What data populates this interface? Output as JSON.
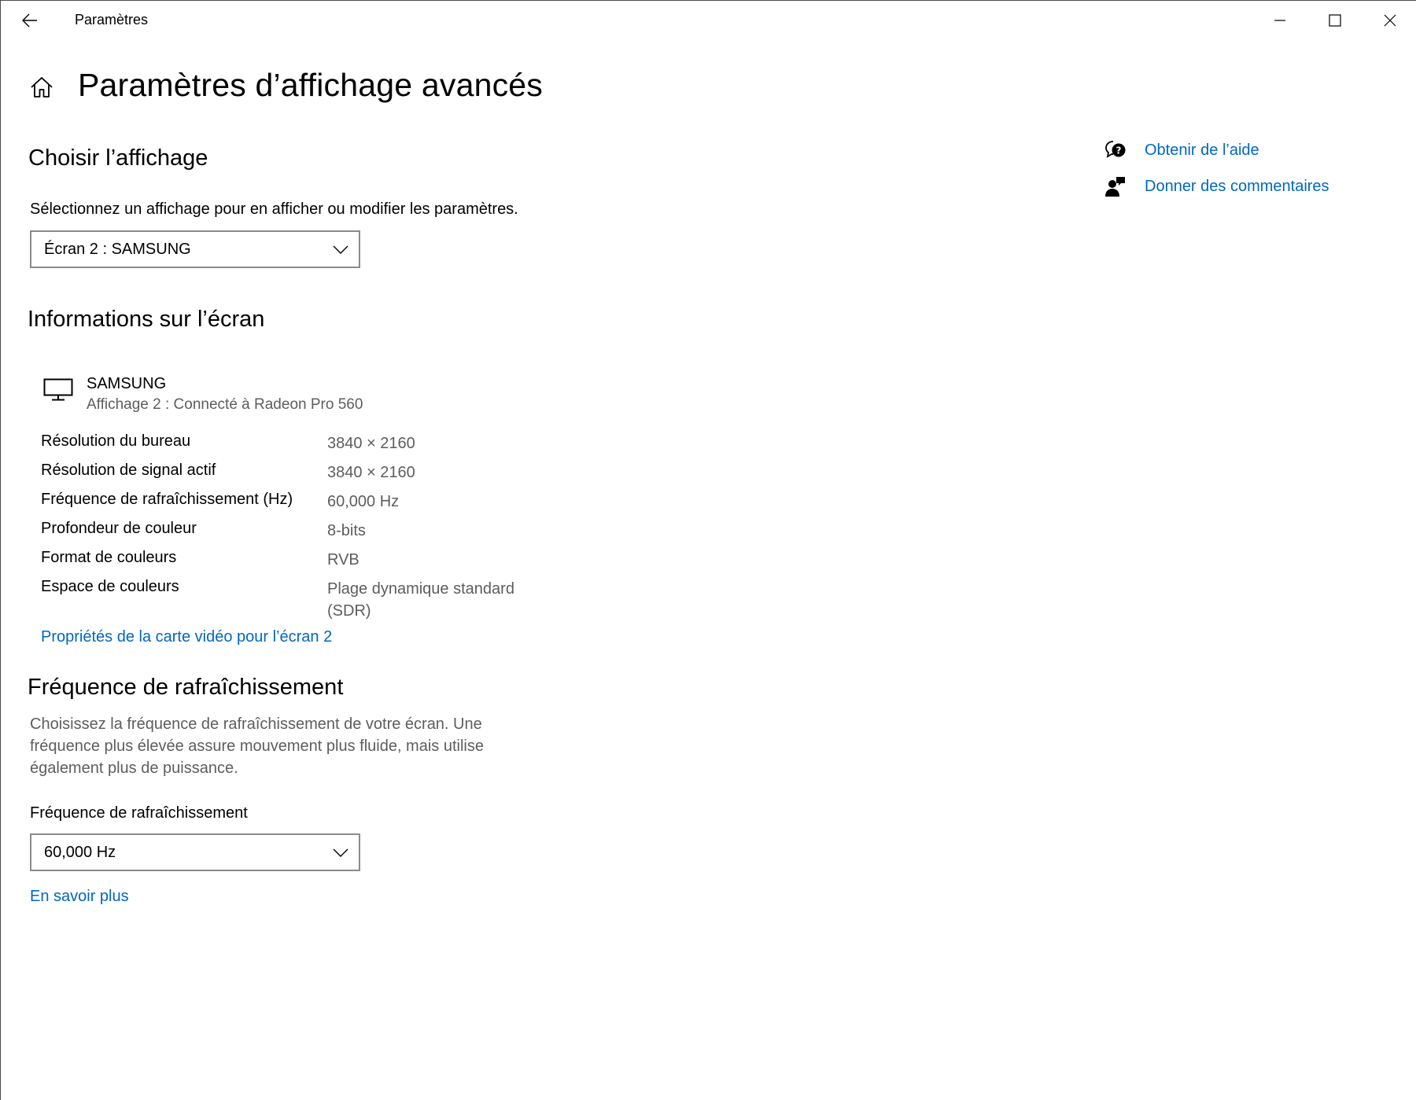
{
  "titlebar": {
    "app_title": "Paramètres"
  },
  "header": {
    "page_title": "Paramètres d’affichage avancés"
  },
  "choose_display": {
    "title": "Choisir l’affichage",
    "description": "Sélectionnez un affichage pour en afficher ou modifier les paramètres.",
    "selected": "Écran 2 : SAMSUNG"
  },
  "display_info": {
    "title": "Informations sur l’écran",
    "monitor_name": "SAMSUNG",
    "monitor_subtitle": "Affichage 2 : Connecté à Radeon Pro 560",
    "rows": [
      {
        "label": "Résolution du bureau",
        "value": "3840 × 2160"
      },
      {
        "label": "Résolution de signal actif",
        "value": "3840 × 2160"
      },
      {
        "label": "Fréquence de rafraîchissement (Hz)",
        "value": "60,000 Hz"
      },
      {
        "label": "Profondeur de couleur",
        "value": "8-bits"
      },
      {
        "label": "Format de couleurs",
        "value": "RVB"
      },
      {
        "label": "Espace de couleurs",
        "value": "Plage dynamique standard (SDR)"
      }
    ],
    "adapter_link": "Propriétés de la carte vidéo pour l’écran 2"
  },
  "refresh_rate": {
    "title": "Fréquence de rafraîchissement",
    "description": "Choisissez la fréquence de rafraîchissement de votre écran. Une fréquence plus élevée assure mouvement plus fluide, mais utilise également plus de puissance.",
    "field_label": "Fréquence de rafraîchissement",
    "selected": "60,000 Hz",
    "learn_more": "En savoir plus"
  },
  "side_links": {
    "help": "Obtenir de l’aide",
    "feedback": "Donner des commentaires"
  },
  "colors": {
    "link": "#0067c0",
    "muted_text": "#5d5d5d",
    "dropdown_border": "#8a8a8a"
  }
}
